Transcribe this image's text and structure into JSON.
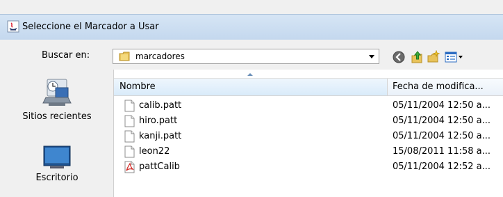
{
  "dialog": {
    "title": "Seleccione el Marcador a Usar"
  },
  "lookin": {
    "label": "Buscar en:",
    "value": "marcadores"
  },
  "toolbar": {
    "icons": [
      "back-icon",
      "up-folder-icon",
      "new-folder-icon",
      "view-menu-icon"
    ]
  },
  "places": [
    {
      "label": "Sitios recientes",
      "icon": "recent-places-icon"
    },
    {
      "label": "Escritorio",
      "icon": "desktop-icon"
    }
  ],
  "table": {
    "columns": [
      "Nombre",
      "Fecha de modifica..."
    ],
    "rows": [
      {
        "name": "calib.patt",
        "date": "05/11/2004 12:50 a...",
        "icon": "file-icon"
      },
      {
        "name": "hiro.patt",
        "date": "05/11/2004 12:50 a...",
        "icon": "file-icon"
      },
      {
        "name": "kanji.patt",
        "date": "05/11/2004 12:50 a...",
        "icon": "file-icon"
      },
      {
        "name": "leon22",
        "date": "15/08/2011 11:58 a...",
        "icon": "file-icon"
      },
      {
        "name": "pattCalib",
        "date": "05/11/2004 12:52 a...",
        "icon": "pdf-file-icon"
      }
    ]
  }
}
